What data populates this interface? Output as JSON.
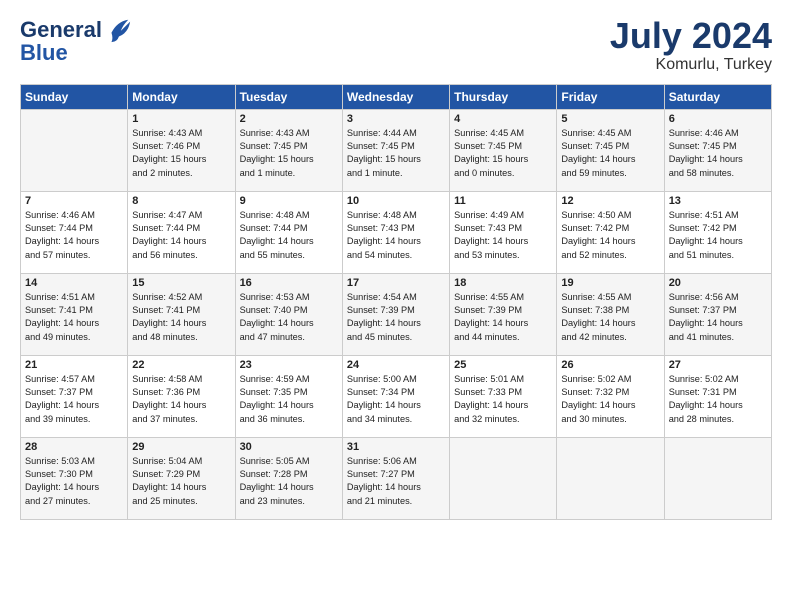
{
  "header": {
    "logo_line1": "General",
    "logo_line2": "Blue",
    "month": "July 2024",
    "location": "Komurlu, Turkey"
  },
  "days_of_week": [
    "Sunday",
    "Monday",
    "Tuesday",
    "Wednesday",
    "Thursday",
    "Friday",
    "Saturday"
  ],
  "weeks": [
    [
      {
        "day": "",
        "info": ""
      },
      {
        "day": "1",
        "info": "Sunrise: 4:43 AM\nSunset: 7:46 PM\nDaylight: 15 hours\nand 2 minutes."
      },
      {
        "day": "2",
        "info": "Sunrise: 4:43 AM\nSunset: 7:45 PM\nDaylight: 15 hours\nand 1 minute."
      },
      {
        "day": "3",
        "info": "Sunrise: 4:44 AM\nSunset: 7:45 PM\nDaylight: 15 hours\nand 1 minute."
      },
      {
        "day": "4",
        "info": "Sunrise: 4:45 AM\nSunset: 7:45 PM\nDaylight: 15 hours\nand 0 minutes."
      },
      {
        "day": "5",
        "info": "Sunrise: 4:45 AM\nSunset: 7:45 PM\nDaylight: 14 hours\nand 59 minutes."
      },
      {
        "day": "6",
        "info": "Sunrise: 4:46 AM\nSunset: 7:45 PM\nDaylight: 14 hours\nand 58 minutes."
      }
    ],
    [
      {
        "day": "7",
        "info": "Sunrise: 4:46 AM\nSunset: 7:44 PM\nDaylight: 14 hours\nand 57 minutes."
      },
      {
        "day": "8",
        "info": "Sunrise: 4:47 AM\nSunset: 7:44 PM\nDaylight: 14 hours\nand 56 minutes."
      },
      {
        "day": "9",
        "info": "Sunrise: 4:48 AM\nSunset: 7:44 PM\nDaylight: 14 hours\nand 55 minutes."
      },
      {
        "day": "10",
        "info": "Sunrise: 4:48 AM\nSunset: 7:43 PM\nDaylight: 14 hours\nand 54 minutes."
      },
      {
        "day": "11",
        "info": "Sunrise: 4:49 AM\nSunset: 7:43 PM\nDaylight: 14 hours\nand 53 minutes."
      },
      {
        "day": "12",
        "info": "Sunrise: 4:50 AM\nSunset: 7:42 PM\nDaylight: 14 hours\nand 52 minutes."
      },
      {
        "day": "13",
        "info": "Sunrise: 4:51 AM\nSunset: 7:42 PM\nDaylight: 14 hours\nand 51 minutes."
      }
    ],
    [
      {
        "day": "14",
        "info": "Sunrise: 4:51 AM\nSunset: 7:41 PM\nDaylight: 14 hours\nand 49 minutes."
      },
      {
        "day": "15",
        "info": "Sunrise: 4:52 AM\nSunset: 7:41 PM\nDaylight: 14 hours\nand 48 minutes."
      },
      {
        "day": "16",
        "info": "Sunrise: 4:53 AM\nSunset: 7:40 PM\nDaylight: 14 hours\nand 47 minutes."
      },
      {
        "day": "17",
        "info": "Sunrise: 4:54 AM\nSunset: 7:39 PM\nDaylight: 14 hours\nand 45 minutes."
      },
      {
        "day": "18",
        "info": "Sunrise: 4:55 AM\nSunset: 7:39 PM\nDaylight: 14 hours\nand 44 minutes."
      },
      {
        "day": "19",
        "info": "Sunrise: 4:55 AM\nSunset: 7:38 PM\nDaylight: 14 hours\nand 42 minutes."
      },
      {
        "day": "20",
        "info": "Sunrise: 4:56 AM\nSunset: 7:37 PM\nDaylight: 14 hours\nand 41 minutes."
      }
    ],
    [
      {
        "day": "21",
        "info": "Sunrise: 4:57 AM\nSunset: 7:37 PM\nDaylight: 14 hours\nand 39 minutes."
      },
      {
        "day": "22",
        "info": "Sunrise: 4:58 AM\nSunset: 7:36 PM\nDaylight: 14 hours\nand 37 minutes."
      },
      {
        "day": "23",
        "info": "Sunrise: 4:59 AM\nSunset: 7:35 PM\nDaylight: 14 hours\nand 36 minutes."
      },
      {
        "day": "24",
        "info": "Sunrise: 5:00 AM\nSunset: 7:34 PM\nDaylight: 14 hours\nand 34 minutes."
      },
      {
        "day": "25",
        "info": "Sunrise: 5:01 AM\nSunset: 7:33 PM\nDaylight: 14 hours\nand 32 minutes."
      },
      {
        "day": "26",
        "info": "Sunrise: 5:02 AM\nSunset: 7:32 PM\nDaylight: 14 hours\nand 30 minutes."
      },
      {
        "day": "27",
        "info": "Sunrise: 5:02 AM\nSunset: 7:31 PM\nDaylight: 14 hours\nand 28 minutes."
      }
    ],
    [
      {
        "day": "28",
        "info": "Sunrise: 5:03 AM\nSunset: 7:30 PM\nDaylight: 14 hours\nand 27 minutes."
      },
      {
        "day": "29",
        "info": "Sunrise: 5:04 AM\nSunset: 7:29 PM\nDaylight: 14 hours\nand 25 minutes."
      },
      {
        "day": "30",
        "info": "Sunrise: 5:05 AM\nSunset: 7:28 PM\nDaylight: 14 hours\nand 23 minutes."
      },
      {
        "day": "31",
        "info": "Sunrise: 5:06 AM\nSunset: 7:27 PM\nDaylight: 14 hours\nand 21 minutes."
      },
      {
        "day": "",
        "info": ""
      },
      {
        "day": "",
        "info": ""
      },
      {
        "day": "",
        "info": ""
      }
    ]
  ]
}
